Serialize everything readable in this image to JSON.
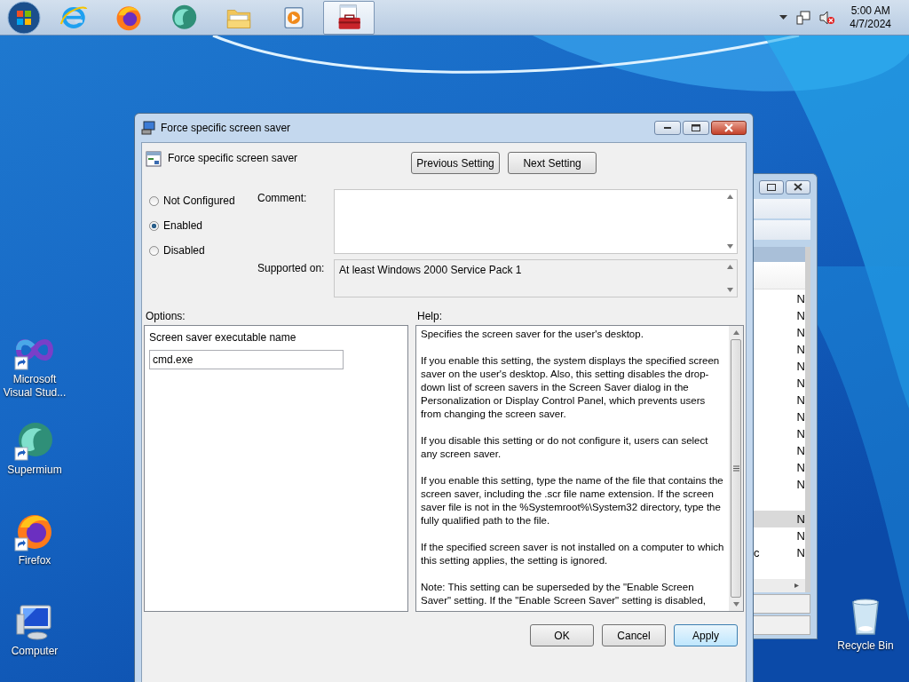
{
  "taskbar": {
    "apps": [
      {
        "kind": "ie",
        "selected": false
      },
      {
        "kind": "firefox",
        "selected": false
      },
      {
        "kind": "supermium",
        "selected": false
      },
      {
        "kind": "explorer",
        "selected": false
      },
      {
        "kind": "player",
        "selected": false
      },
      {
        "kind": "toolbox",
        "selected": true
      }
    ]
  },
  "tray": {
    "time": "5:00 AM",
    "date": "4/7/2024"
  },
  "desktop": {
    "left_icons": [
      {
        "label": "Microsoft Visual Stud...",
        "kind": "vs",
        "shortcut": true
      },
      {
        "label": "Supermium",
        "kind": "supermium",
        "shortcut": true
      },
      {
        "label": "Firefox",
        "kind": "firefox",
        "shortcut": true
      },
      {
        "label": "Computer",
        "kind": "computer",
        "shortcut": false
      }
    ],
    "right_icons": [
      {
        "label": "Recycle Bin",
        "kind": "bin",
        "shortcut": false
      }
    ]
  },
  "background_window": {
    "groups": [
      {
        "rows": [
          {
            "state": "N",
            "selected": false
          },
          {
            "state": "N",
            "selected": false
          },
          {
            "state": "N",
            "selected": false
          },
          {
            "state": "N",
            "selected": false
          },
          {
            "state": "N",
            "selected": false
          },
          {
            "state": "N",
            "selected": false
          },
          {
            "state": "N",
            "selected": false
          },
          {
            "state": "N",
            "selected": false
          },
          {
            "state": "N",
            "selected": false
          },
          {
            "state": "N",
            "selected": false
          },
          {
            "state": "N",
            "selected": false
          },
          {
            "state": "N",
            "selected": false
          }
        ]
      },
      {
        "rows": [
          {
            "state": "N",
            "selected": true
          },
          {
            "state": "N",
            "selected": false
          },
          {
            "name": "c",
            "state": "N",
            "selected": false
          }
        ]
      }
    ]
  },
  "dialog": {
    "title": "Force specific screen saver",
    "heading": "Force specific screen saver",
    "nav_buttons": [
      "Previous Setting",
      "Next Setting"
    ],
    "states": [
      {
        "label": "Not Configured",
        "selected": false
      },
      {
        "label": "Enabled",
        "selected": true
      },
      {
        "label": "Disabled",
        "selected": false
      }
    ],
    "comment_label": "Comment:",
    "supported_label": "Supported on:",
    "supported": "At least Windows 2000 Service Pack 1",
    "options_label": "Options:",
    "help_label": "Help:",
    "option": {
      "label": "Screen saver executable name",
      "value": "cmd.exe"
    },
    "help": [
      "Specifies the screen saver for the user's desktop.",
      "If you enable this setting, the system displays the specified screen saver on the user's desktop. Also, this setting disables the drop-down list of screen savers in the Screen Saver dialog in the Personalization or Display Control Panel, which prevents users from changing the screen saver.",
      "If you disable this setting or do not configure it, users can select any screen saver.",
      "If you enable this setting, type the name of the file that contains the screen saver, including the .scr file name extension. If the screen saver file is not in the %Systemroot%\\System32 directory, type the fully qualified path to the file.",
      "If the specified screen saver is not installed on a computer to which this setting applies, the setting is ignored.",
      "Note: This setting can be superseded by the \"Enable Screen Saver\" setting.  If the \"Enable Screen Saver\" setting is disabled,"
    ],
    "buttons": [
      {
        "label": "OK",
        "hovered": false
      },
      {
        "label": "Cancel",
        "hovered": false
      },
      {
        "label": "Apply",
        "hovered": true
      }
    ]
  }
}
